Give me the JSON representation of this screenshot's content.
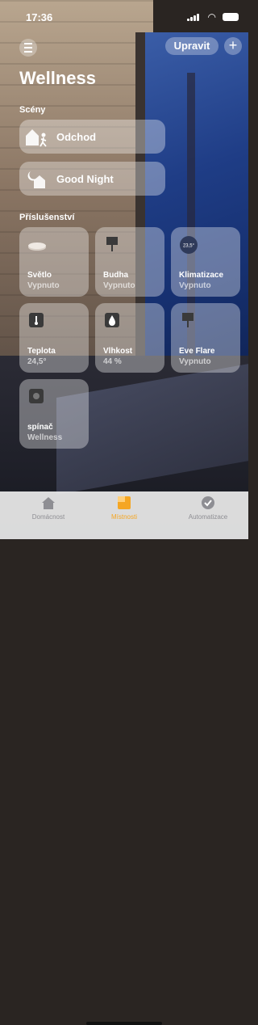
{
  "status_bar": {
    "time": "17:36"
  },
  "header": {
    "edit_label": "Upravit",
    "add_label": "+",
    "title": "Wellness"
  },
  "scenes_section": {
    "label": "Scény"
  },
  "scenes": [
    {
      "label": "Odchod",
      "icon": "house-person-icon"
    },
    {
      "label": "Good Night",
      "icon": "house-moon-icon"
    }
  ],
  "accessories_section": {
    "label": "Příslušenství"
  },
  "accessories": [
    {
      "name": "Světlo",
      "status": "Vypnuto",
      "icon": "light-icon"
    },
    {
      "name": "Budha",
      "status": "Vypnuto",
      "icon": "lamp-icon"
    },
    {
      "name": "Klimatizace",
      "status": "Vypnuto",
      "icon": "thermostat-icon",
      "icon_text": "23,5°"
    },
    {
      "name": "Teplota",
      "status": "24,5°",
      "icon": "temperature-sensor-icon"
    },
    {
      "name": "Vlhkost",
      "status": "44 %",
      "icon": "humidity-sensor-icon"
    },
    {
      "name": "Eve Flare",
      "status": "Vypnuto",
      "icon": "lamp-icon"
    },
    {
      "name": "spínač",
      "status": "Wellness",
      "icon": "switch-icon"
    }
  ],
  "tabbar": [
    {
      "label": "Domácnost",
      "icon": "house-icon",
      "active": false
    },
    {
      "label": "Místnosti",
      "icon": "rooms-icon",
      "active": true
    },
    {
      "label": "Automatizace",
      "icon": "automation-icon",
      "active": false
    }
  ],
  "colors": {
    "accent": "#f5a623",
    "tile_bg": "rgba(255,255,255,0.35)"
  }
}
